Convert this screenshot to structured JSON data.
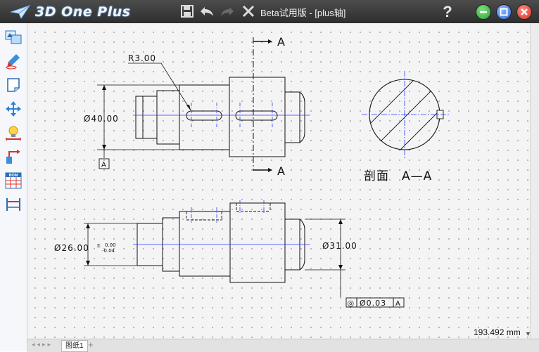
{
  "app": {
    "logo_text": "3D One Plus",
    "window_title": "Beta试用版 - [plus轴]",
    "help_label": "?"
  },
  "colors": {
    "titlebar": "#3a3a3a",
    "minimize": "#2fa336",
    "maximize": "#2f6fd6",
    "close": "#d9332b",
    "centerline": "#2a3cff"
  },
  "toolbar": {
    "icons": [
      "save-icon",
      "undo-icon",
      "redo-icon",
      "close-x-icon"
    ]
  },
  "left_toolbar": {
    "tools": [
      "view-layout-icon",
      "sketch-pen-icon",
      "sheet-icon",
      "move-icon",
      "annotation-light-icon",
      "leader-icon",
      "bom-table-icon",
      "dimension-icon"
    ],
    "bom_label": "BOM"
  },
  "drawing": {
    "radius_label": "R3.00",
    "dia40_label": "Ø40.00",
    "dia26_label": "Ø26.00",
    "tol_upper": "0.00",
    "tol_lower": "-0.04",
    "dia31_label": "Ø31.00",
    "datum_label": "A",
    "section_arrow_top": "A",
    "section_arrow_bottom": "A",
    "section_title": "剖面　A—A",
    "fcf_symbol": "◎",
    "fcf_tolerance": "Ø0.03",
    "fcf_datum": "A"
  },
  "status": {
    "sheet_tab": "图纸1",
    "add_sheet": "+",
    "measurement": "193.492 mm"
  }
}
